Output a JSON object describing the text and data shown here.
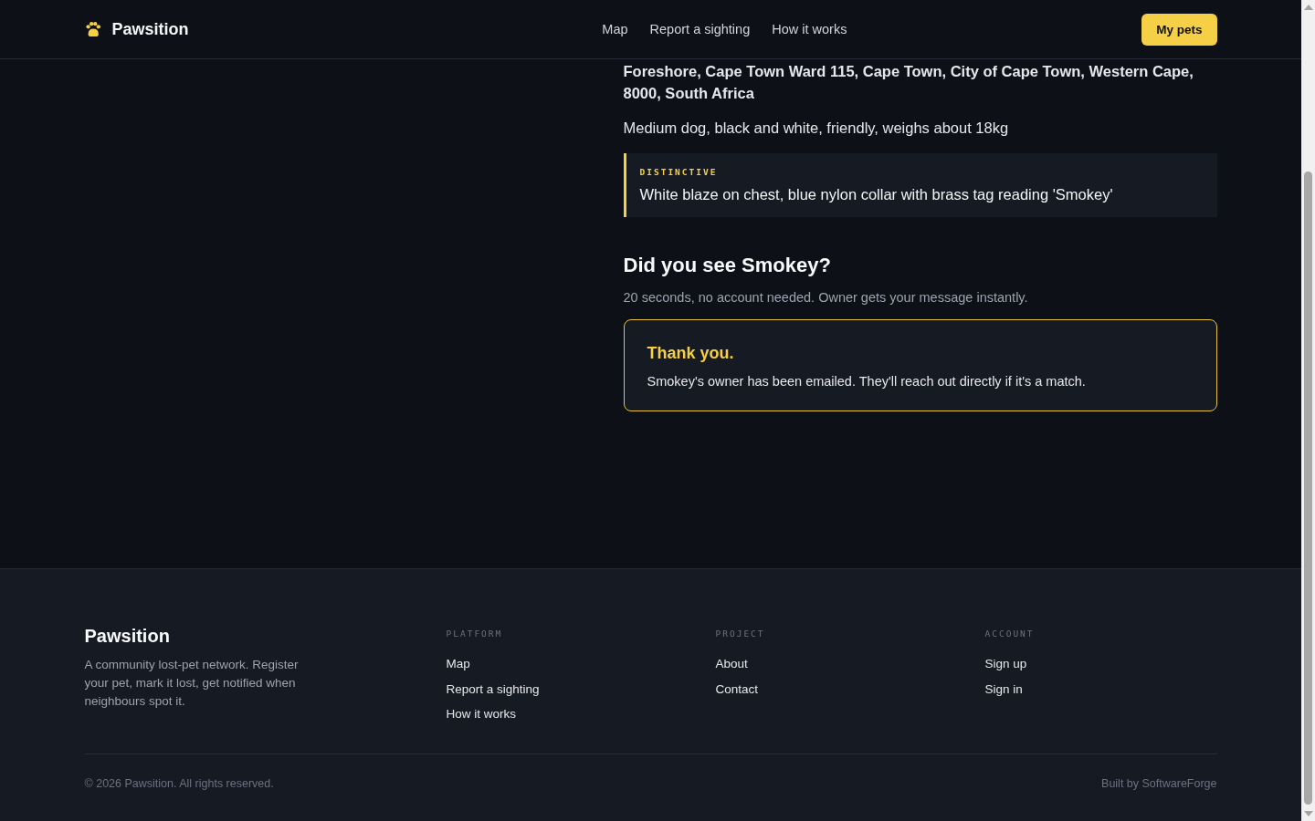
{
  "header": {
    "brand": "Pawsition",
    "nav": [
      "Map",
      "Report a sighting",
      "How it works"
    ],
    "button": "My pets"
  },
  "sighting": {
    "address_lines": [
      "Foreshore, Cape Town Ward 115, Cape Town, City of Cape Town, Western Cape,",
      "8000, South Africa"
    ],
    "description": "Medium dog, black and white, friendly, weighs about 18kg",
    "distinctive": {
      "label": "DISTINCTIVE",
      "text": "White blaze on chest, blue nylon collar with brass tag reading 'Smokey'"
    }
  },
  "report": {
    "heading": "Did you see Smokey?",
    "subtitle": "20 seconds, no account needed. Owner gets your message instantly.",
    "confirmation": {
      "title": "Thank you.",
      "message": "Smokey's owner has been emailed. They'll reach out directly if it's a match."
    }
  },
  "footer": {
    "brand": "Pawsition",
    "tagline": "A community lost-pet network. Register your pet, mark it lost, get notified when neighbours spot it.",
    "columns": [
      {
        "title": "PLATFORM",
        "links": [
          "Map",
          "Report a sighting",
          "How it works"
        ]
      },
      {
        "title": "PROJECT",
        "links": [
          "About",
          "Contact"
        ]
      },
      {
        "title": "ACCOUNT",
        "links": [
          "Sign up",
          "Sign in"
        ]
      }
    ],
    "copyright": "© 2026 Pawsition. All rights reserved.",
    "credit": "Built by SoftwareForge"
  }
}
